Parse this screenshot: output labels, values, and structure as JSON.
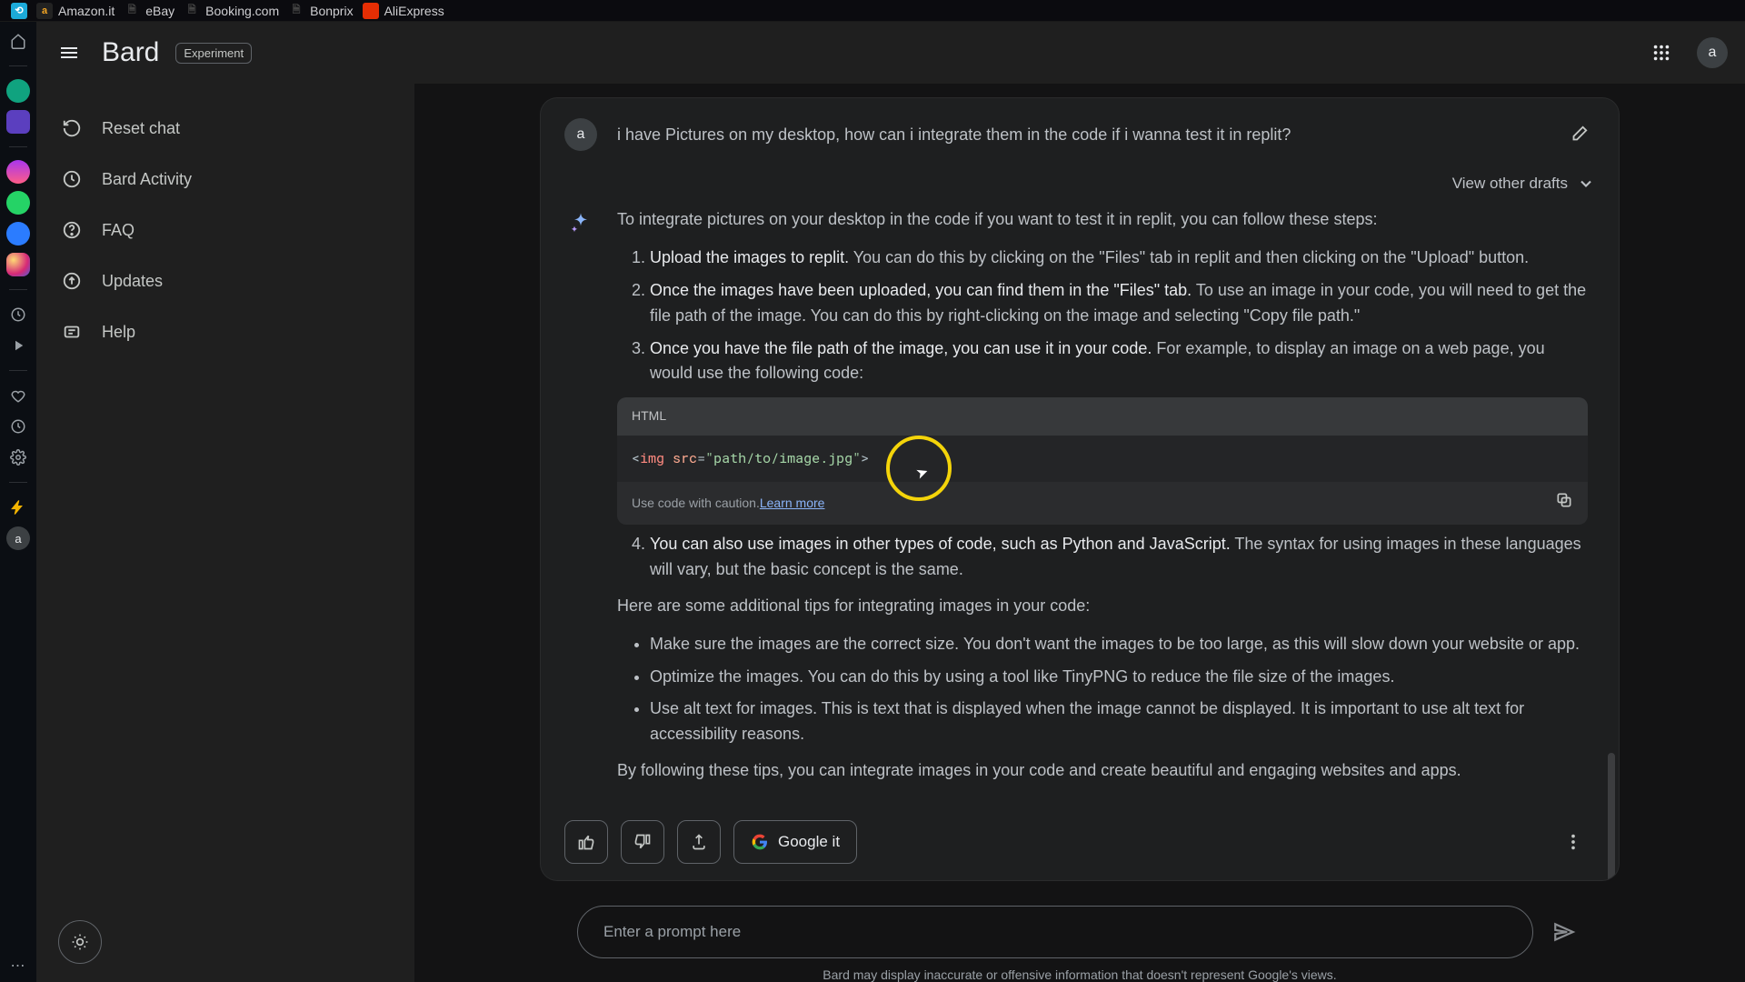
{
  "bookmarks": [
    {
      "label": "Amazon.it",
      "fav_bg": "#f5a623",
      "fav_txt": "a"
    },
    {
      "label": "eBay",
      "fav_bg": "#e6e6e6",
      "fav_txt": "▤"
    },
    {
      "label": "Booking.com",
      "fav_bg": "#e6e6e6",
      "fav_txt": "▤"
    },
    {
      "label": "Bonprix",
      "fav_bg": "#e6e6e6",
      "fav_txt": "▤"
    },
    {
      "label": "AliExpress",
      "fav_bg": "#e62e04",
      "fav_txt": ""
    }
  ],
  "header": {
    "app_title": "Bard",
    "experiment_label": "Experiment",
    "profile_letter": "a"
  },
  "sidebar": {
    "items": [
      {
        "icon": "refresh",
        "label": "Reset chat"
      },
      {
        "icon": "history",
        "label": "Bard Activity"
      },
      {
        "icon": "help",
        "label": "FAQ"
      },
      {
        "icon": "upgrade",
        "label": "Updates"
      },
      {
        "icon": "assist",
        "label": "Help"
      }
    ]
  },
  "chat": {
    "user_avatar": "a",
    "user_message": "i have Pictures on my desktop, how can i integrate them in the code if i wanna test it in replit?",
    "view_drafts_label": "View other drafts",
    "intro": "To integrate pictures on your desktop in the code if you want to test it in replit, you can follow these steps:",
    "steps": [
      {
        "bold": "Upload the images to replit.",
        "rest": " You can do this by clicking on the \"Files\" tab in replit and then clicking on the \"Upload\" button."
      },
      {
        "bold": "Once the images have been uploaded, you can find them in the \"Files\" tab.",
        "rest": " To use an image in your code, you will need to get the file path of the image. You can do this by right-clicking on the image and selecting \"Copy file path.\""
      },
      {
        "bold": "Once you have the file path of the image, you can use it in your code.",
        "rest": " For example, to display an image on a web page, you would use the following code:"
      }
    ],
    "code": {
      "lang_label": "HTML",
      "tag_name": "img",
      "attr_name": "src",
      "attr_value": "\"path/to/image.jpg\"",
      "caution_text": "Use code with caution. ",
      "learn_more": "Learn more"
    },
    "step4": {
      "bold": "You can also use images in other types of code, such as Python and JavaScript.",
      "rest": " The syntax for using images in these languages will vary, but the basic concept is the same."
    },
    "tips_intro": "Here are some additional tips for integrating images in your code:",
    "tips": [
      "Make sure the images are the correct size. You don't want the images to be too large, as this will slow down your website or app.",
      "Optimize the images. You can do this by using a tool like TinyPNG to reduce the file size of the images.",
      "Use alt text for images. This is text that is displayed when the image cannot be displayed. It is important to use alt text for accessibility reasons."
    ],
    "conclusion": "By following these tips, you can integrate images in your code and create beautiful and engaging websites and apps.",
    "google_it_label": "Google it"
  },
  "input": {
    "placeholder": "Enter a prompt here"
  },
  "disclaimer": "Bard may display inaccurate or offensive information that doesn't represent Google's views."
}
